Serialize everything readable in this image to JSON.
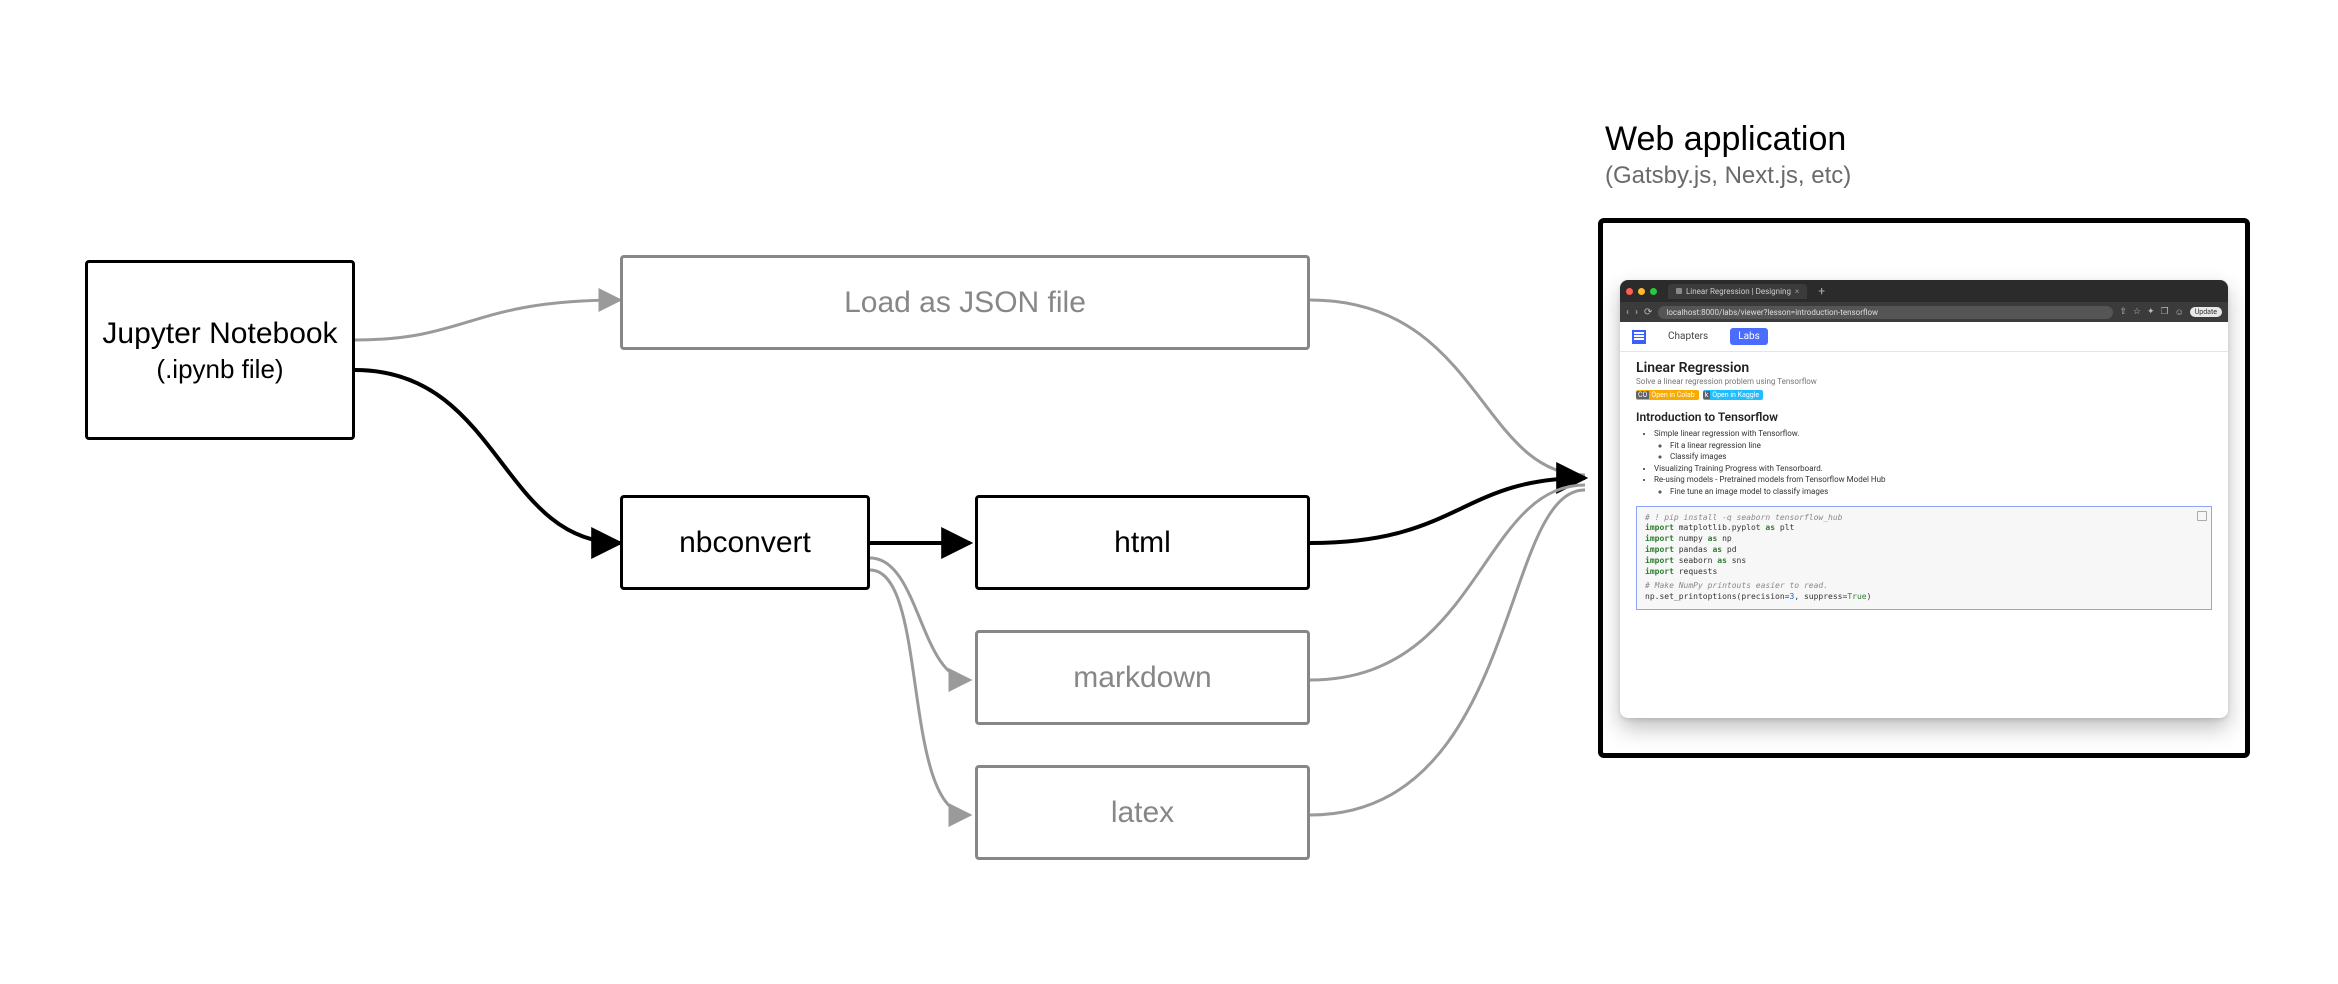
{
  "nodes": {
    "source": {
      "line1": "Jupyter Notebook",
      "line2": "(.ipynb file)"
    },
    "json": "Load as JSON file",
    "nbconvert": "nbconvert",
    "html": "html",
    "markdown": "markdown",
    "latex": "latex"
  },
  "webapp": {
    "title": "Web application",
    "subtitle": "(Gatsby.js, Next.js, etc)"
  },
  "browser": {
    "tab_title": "Linear Regression | Designing",
    "url": "localhost:8000/labs/viewer?lesson=introduction-tensorflow",
    "update_btn": "Update",
    "nav": {
      "chapters": "Chapters",
      "labs": "Labs"
    },
    "page": {
      "h1": "Linear Regression",
      "sub": "Solve a linear regression problem using Tensorflow",
      "badge_colab": "Open in Colab",
      "badge_kaggle": "Open in Kaggle",
      "h2": "Introduction to Tensorflow",
      "toc": [
        "Simple linear regression with Tensorflow.",
        [
          "Fit a linear regression line",
          "Classify images"
        ],
        "Visualizing Training Progress with Tensorboard.",
        "Re-using models - Pretrained models from Tensorflow Model Hub",
        [
          "Fine tune an image model to classify images"
        ]
      ]
    },
    "code": {
      "l1": "# ! pip install -q seaborn tensorflow_hub",
      "l2a": "import",
      "l2b": " matplotlib.pyplot ",
      "l2c": "as",
      "l2d": " plt",
      "l3a": "import",
      "l3b": " numpy ",
      "l3c": "as",
      "l3d": " np",
      "l4a": "import",
      "l4b": " pandas ",
      "l4c": "as",
      "l4d": " pd",
      "l5a": "import",
      "l5b": " seaborn ",
      "l5c": "as",
      "l5d": " sns",
      "l6a": "import",
      "l6b": " requests",
      "l7": "# Make NumPy printouts easier to read.",
      "l8a": "np.set_printoptions(precision=",
      "l8b": "3",
      "l8c": ", suppress=",
      "l8d": "True",
      "l8e": ")"
    }
  }
}
